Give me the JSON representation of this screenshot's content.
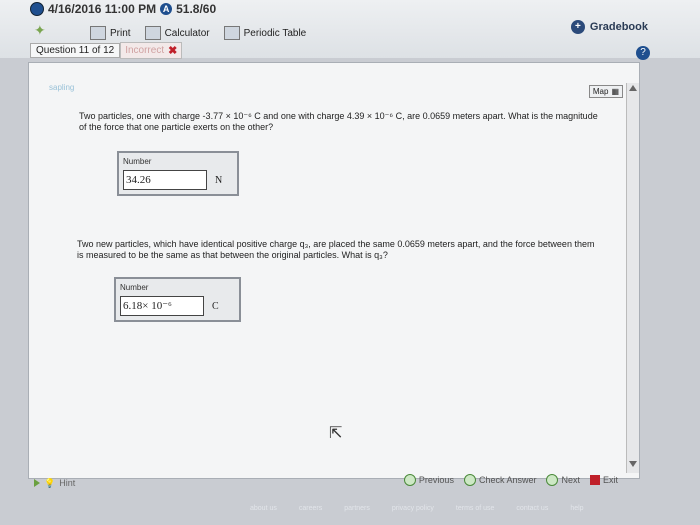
{
  "header": {
    "datetime": "4/16/2016 11:00 PM",
    "score": "51.8/60",
    "tools": {
      "print": "Print",
      "calculator": "Calculator",
      "periodic": "Periodic Table"
    },
    "gradebook": "Gradebook",
    "question_label": "Question 11 of 12",
    "status": "Incorrect"
  },
  "content": {
    "sapling": "sapling",
    "map": "Map",
    "q1_text": "Two particles, one with charge -3.77 × 10⁻⁶ C and one with charge 4.39 × 10⁻⁶ C, are 0.0659 meters apart. What is the magnitude of the force that one particle exerts on the other?",
    "q2_text": "Two new particles, which have identical positive charge q₃, are placed the same 0.0659 meters apart, and the force between them is measured to be the same as that between the original particles. What is q₃?",
    "number_label": "Number",
    "answer1": "34.26",
    "unit1": "N",
    "answer2": "6.18× 10⁻⁶",
    "unit2": "C"
  },
  "bottom": {
    "hint": "Hint",
    "previous": "Previous",
    "check": "Check Answer",
    "next": "Next",
    "exit": "Exit"
  },
  "footer": [
    "about us",
    "careers",
    "partners",
    "privacy policy",
    "terms of use",
    "contact us",
    "help"
  ]
}
